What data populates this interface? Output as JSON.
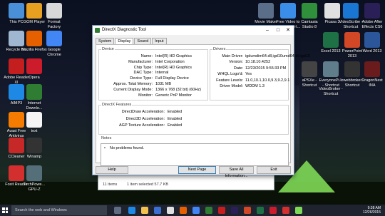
{
  "desktop_icons": [
    {
      "label": "This PC",
      "color": "#4a90d9"
    },
    {
      "label": "GOM Player",
      "color": "#e8a020"
    },
    {
      "label": "Format Factory",
      "color": "#d8d8d8"
    },
    {
      "label": "Recycle Bin",
      "color": "#9fb7d0"
    },
    {
      "label": "Mozilla Firefox",
      "color": "#e66000"
    },
    {
      "label": "Google Chrome",
      "color": "#4285f4"
    },
    {
      "label": "Adobe Reader XI",
      "color": "#c41e1e"
    },
    {
      "label": "Opera",
      "color": "#cc1b2b"
    },
    {
      "label": "AIMP3",
      "color": "#1e88e5"
    },
    {
      "label": "Internet Downlo...",
      "color": "#2e7d32"
    },
    {
      "label": "Avast Free Antivirus",
      "color": "#f57c00"
    },
    {
      "label": "text",
      "color": "#f5f5f5"
    },
    {
      "label": "CCleaner",
      "color": "#c62828"
    },
    {
      "label": "Winamp",
      "color": "#333333"
    },
    {
      "label": "Foxit Reader",
      "color": "#d32f2f"
    },
    {
      "label": "TechPowe... GPU-Z",
      "color": "#546e7a"
    }
  ],
  "right_icons": [
    {
      "label": "Movie Maker",
      "color": "#5a6e8a"
    },
    {
      "label": "Free Video to GIF Convert...",
      "color": "#3b8ee8"
    },
    {
      "label": "Camtasia Studio 8",
      "color": "#2f8f3a"
    },
    {
      "label": "Picasa 3",
      "color": "#e0e0e0"
    },
    {
      "label": "VideoScribe - Shortcut",
      "color": "#1976d2"
    },
    {
      "label": "Adobe After Effects CS6",
      "color": "#2a1f56"
    },
    {
      "label": "Excel 2013",
      "color": "#1e7145"
    },
    {
      "label": "PowerPoint 2013",
      "color": "#d24726"
    },
    {
      "label": "Word 2013",
      "color": "#2b579a"
    },
    {
      "label": "aPSXe - Shortcut",
      "color": "#444444"
    },
    {
      "label": "EveryonePi... - Shortcut",
      "color": "#607d8b"
    },
    {
      "label": "lowebbroker - Shortcut",
      "color": "#333333"
    },
    {
      "label": "VideoBroker - Shortcut",
      "color": "#222222"
    },
    {
      "label": "DragonNest INA",
      "color": "#6a1b1b"
    }
  ],
  "window": {
    "title": "DirectX Diagnostic Tool",
    "tabs": [
      "System",
      "Display",
      "Sound",
      "Input"
    ],
    "active_tab": "Display",
    "device_title": "Device",
    "drivers_title": "Drivers",
    "device": [
      {
        "label": "Name:",
        "value": "Intel(R) HD Graphics"
      },
      {
        "label": "Manufacturer:",
        "value": "Intel Corporation"
      },
      {
        "label": "Chip Type:",
        "value": "Intel(R) HD Graphics"
      },
      {
        "label": "DAC Type:",
        "value": "Internal"
      },
      {
        "label": "Device Type:",
        "value": "Full Display Device"
      },
      {
        "label": "Approx. Total Memory:",
        "value": "1031 MB"
      },
      {
        "label": "Current Display Mode:",
        "value": "1366 x 768 (32 bit) (60Hz)"
      },
      {
        "label": "Monitor:",
        "value": "Generic PnP Monitor"
      }
    ],
    "drivers": [
      {
        "label": "Main Driver:",
        "value": "igdumdim64.dll,igd10umd64.dll,igd10"
      },
      {
        "label": "Version:",
        "value": "10.18.10.4252"
      },
      {
        "label": "Date:",
        "value": "12/23/2015 9:55:33 PM"
      },
      {
        "label": "WHQL Logo'd:",
        "value": "Yes"
      },
      {
        "label": "Feature Levels:",
        "value": "11.0,10.1,10.0,9.3,9.2,9.1"
      },
      {
        "label": "Driver Model:",
        "value": "WDDM 1.3"
      }
    ],
    "features_title": "DirectX Features",
    "features": [
      {
        "label": "DirectDraw Acceleration:",
        "value": "Enabled"
      },
      {
        "label": "Direct3D Acceleration:",
        "value": "Enabled"
      },
      {
        "label": "AGP Texture Acceleration:",
        "value": "Enabled"
      }
    ],
    "notes_title": "Notes",
    "notes_bullet": "•",
    "notes_text": "No problems found.",
    "buttons": {
      "help": "Help",
      "next": "Next Page",
      "save": "Save All Information...",
      "exit": "Exit"
    }
  },
  "explorer": {
    "items_count": "11 items",
    "selected": "1 item selected 57.7 KB"
  },
  "taskbar": {
    "search_placeholder": "Search the web and Windows",
    "time": "9:38 AM",
    "date": "12/26/2015"
  }
}
